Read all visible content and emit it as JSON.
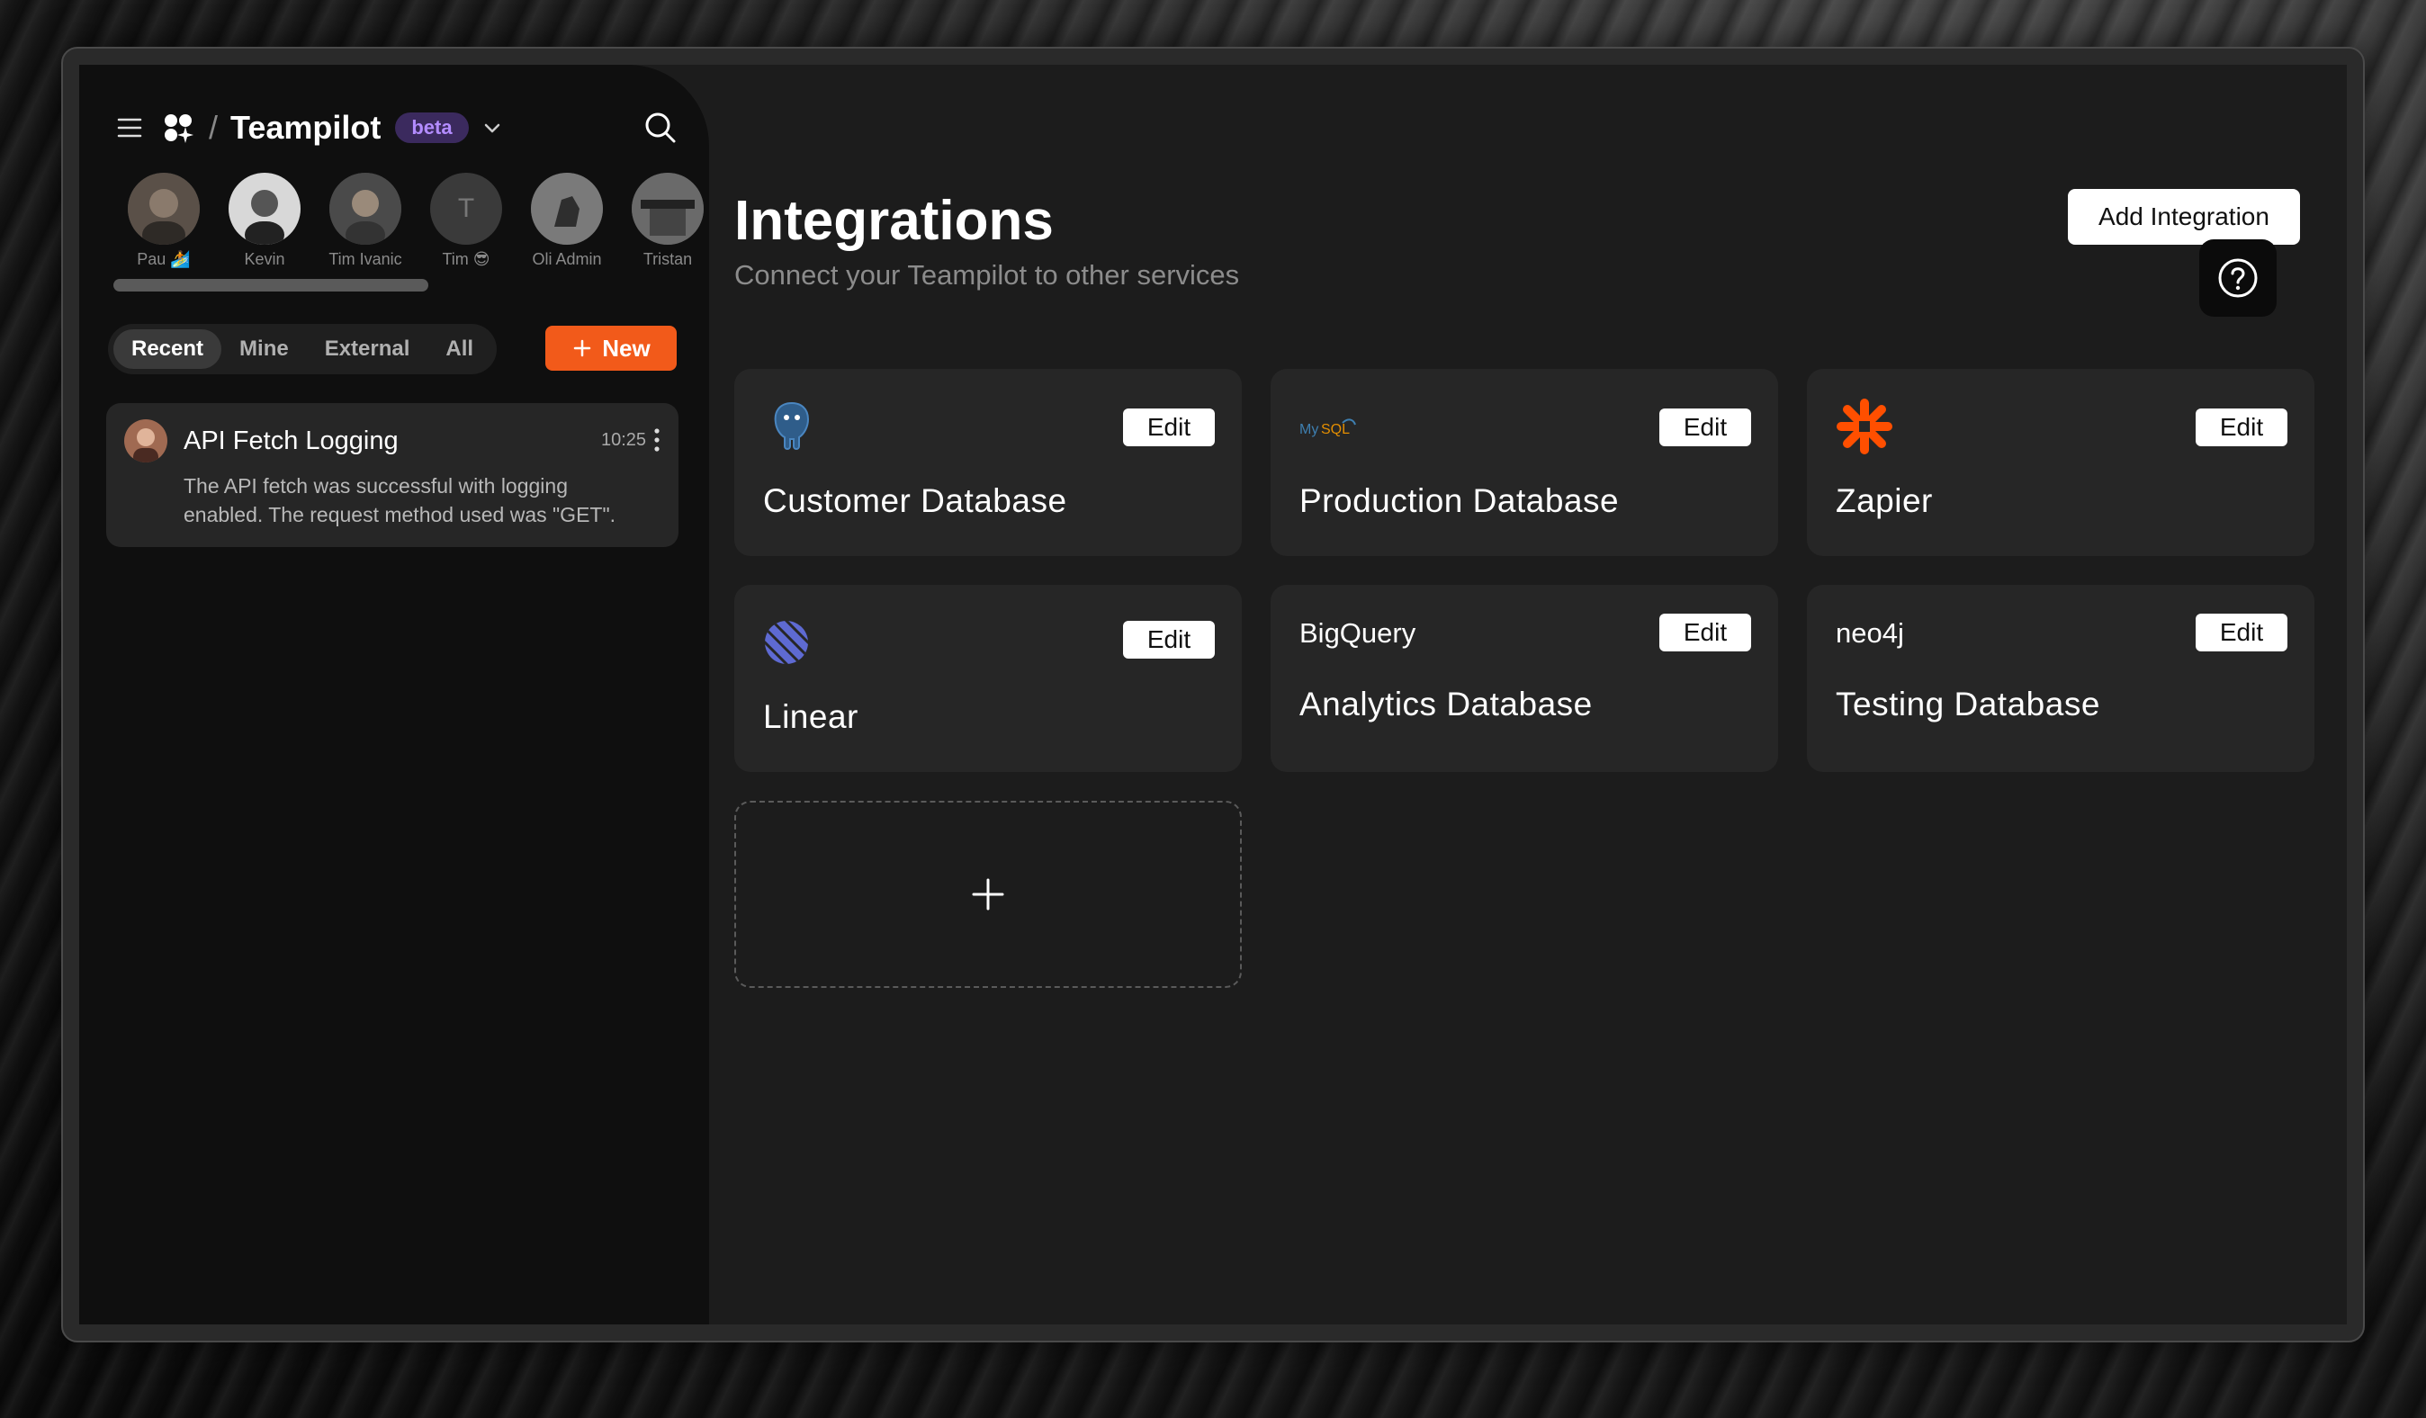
{
  "app": {
    "brand": "Teampilot",
    "badge": "beta"
  },
  "avatars": [
    {
      "name": "Pau 🏄",
      "initial": ""
    },
    {
      "name": "Kevin",
      "initial": ""
    },
    {
      "name": "Tim Ivanic",
      "initial": ""
    },
    {
      "name": "Tim 😎",
      "initial": "T"
    },
    {
      "name": "Oli Admin",
      "initial": ""
    },
    {
      "name": "Tristan",
      "initial": ""
    }
  ],
  "tabs": [
    "Recent",
    "Mine",
    "External",
    "All"
  ],
  "active_tab": "Recent",
  "new_button": "New",
  "chats": [
    {
      "title": "API Fetch Logging",
      "time": "10:25",
      "preview": "The API fetch was successful with logging enabled. The request method used was \"GET\"."
    }
  ],
  "main": {
    "title": "Integrations",
    "subtitle": "Connect your Teampilot to other services",
    "add_button": "Add Integration"
  },
  "cards": [
    {
      "name": "Customer Database",
      "edit": "Edit",
      "logo": "postgresql-icon",
      "logo_text": "PostgreSQL"
    },
    {
      "name": "Production Database",
      "edit": "Edit",
      "logo": "mysql-icon",
      "logo_text": "MySQL"
    },
    {
      "name": "Zapier",
      "edit": "Edit",
      "logo": "zapier-icon",
      "logo_text": ""
    },
    {
      "name": "Linear",
      "edit": "Edit",
      "logo": "linear-icon",
      "logo_text": ""
    },
    {
      "name": "Analytics Database",
      "edit": "Edit",
      "logo": "bigquery-label",
      "logo_text": "BigQuery"
    },
    {
      "name": "Testing Database",
      "edit": "Edit",
      "logo": "neo4j-label",
      "logo_text": "neo4j"
    }
  ],
  "colors": {
    "accent": "#f25a1a",
    "beta_bg": "#3b2a5e",
    "beta_text": "#b38cff",
    "linear": "#5e6ad2",
    "zapier": "#ff4f00"
  }
}
